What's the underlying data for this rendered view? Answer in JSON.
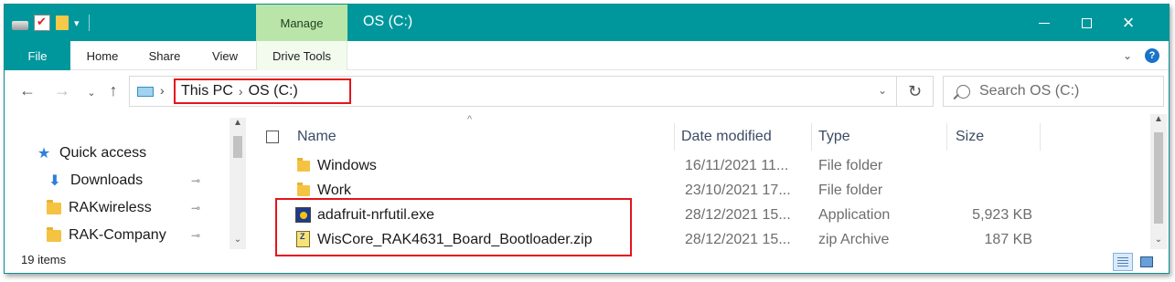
{
  "window": {
    "title": "OS (C:)",
    "contextual_tab": "Manage"
  },
  "colors": {
    "titlebar": "#00979c",
    "manage_tab": "#b9e6a8",
    "highlight_red": "#e4141b",
    "folder_yellow": "#f5c342",
    "quick_access_blue": "#2f7fd7"
  },
  "controls": {
    "minimize_icon": "minimize-icon",
    "maximize_icon": "maximize-icon",
    "close_icon": "×"
  },
  "ribbon": {
    "tabs": [
      "File",
      "Home",
      "Share",
      "View",
      "Drive Tools"
    ],
    "expand_glyph": "⌄",
    "help_glyph": "?"
  },
  "nav": {
    "back": "←",
    "forward": "→",
    "recent": "⌄",
    "up": "↑"
  },
  "address": {
    "crumbs": [
      "This PC",
      "OS (C:)"
    ],
    "sep": "›",
    "leading_sep": "›",
    "dropdown": "⌄",
    "refresh": "↻"
  },
  "search": {
    "placeholder": "Search OS (C:)"
  },
  "sidebar": {
    "items": [
      {
        "label": "Quick access",
        "icon": "star-icon"
      },
      {
        "label": "Downloads",
        "icon": "download-icon",
        "pinned": true
      },
      {
        "label": "RAKwireless",
        "icon": "folder-icon",
        "pinned": true
      },
      {
        "label": "RAK-Company",
        "icon": "folder-icon",
        "pinned": true
      }
    ],
    "pin_glyph": "📌"
  },
  "filelist": {
    "sort_glyph": "^",
    "columns": [
      "Name",
      "Date modified",
      "Type",
      "Size"
    ],
    "rows": [
      {
        "name": "Windows",
        "date": "16/11/2021 11...",
        "type": "File folder",
        "size": "",
        "icon": "folder-icon"
      },
      {
        "name": "Work",
        "date": "23/10/2021 17...",
        "type": "File folder",
        "size": "",
        "icon": "folder-icon"
      },
      {
        "name": "adafruit-nrfutil.exe",
        "date": "28/12/2021 15...",
        "type": "Application",
        "size": "5,923 KB",
        "icon": "exe-icon"
      },
      {
        "name": "WisCore_RAK4631_Board_Bootloader.zip",
        "date": "28/12/2021 15...",
        "type": "zip Archive",
        "size": "187 KB",
        "icon": "zip-icon"
      }
    ]
  },
  "status": {
    "items_count": "19 items"
  },
  "scroll": {
    "up": "▲",
    "down": "⌄"
  }
}
